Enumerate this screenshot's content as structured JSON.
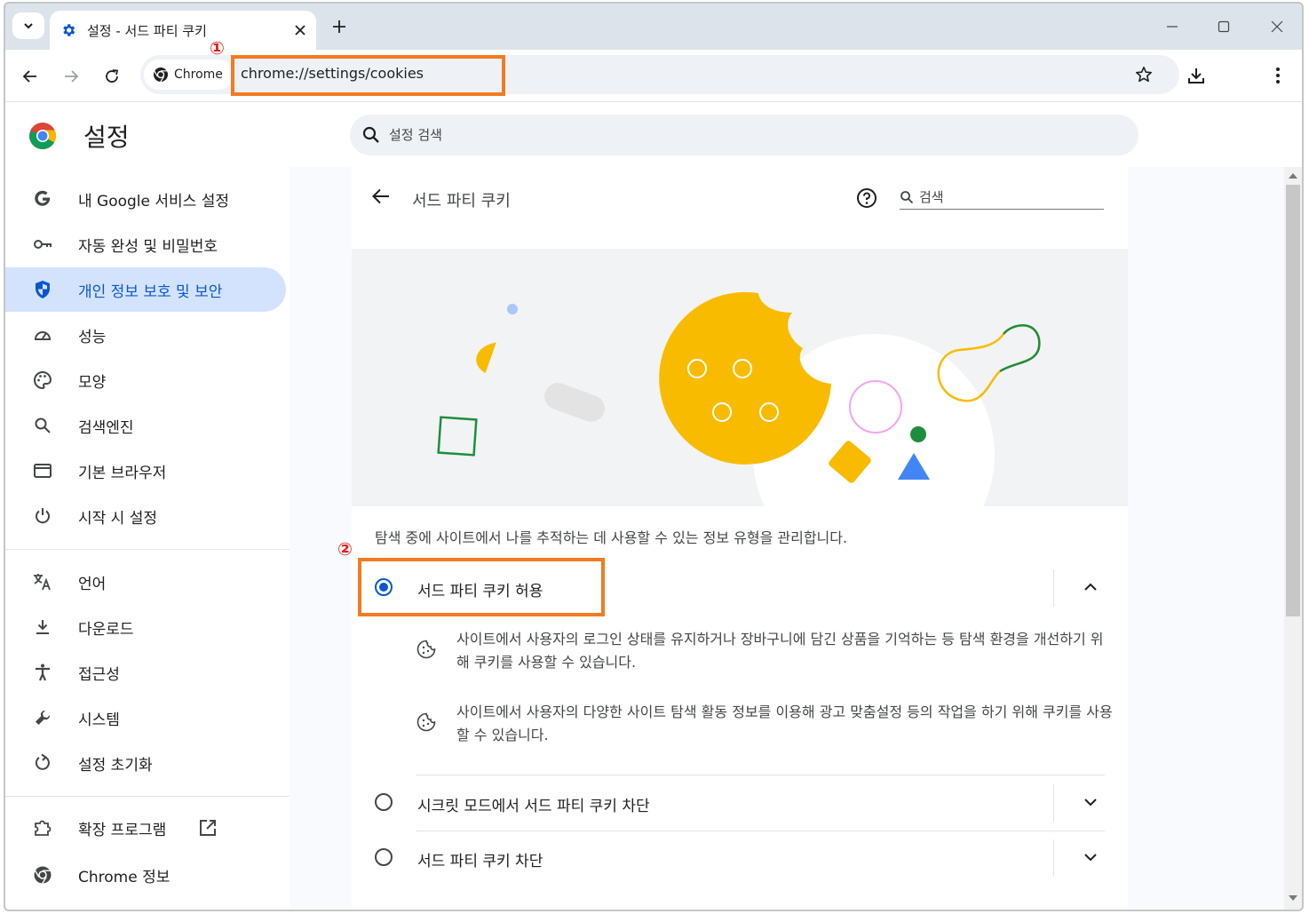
{
  "tab": {
    "title": "설정 - 서드 파티 쿠키"
  },
  "toolbar": {
    "chip_label": "Chrome",
    "url": "chrome://settings/cookies"
  },
  "annotations": {
    "mark1": "①",
    "mark2": "②",
    "highlight_color": "#f37b21",
    "mark_color": "#e0251b"
  },
  "header": {
    "title": "설정",
    "search_placeholder": "설정 검색"
  },
  "sidebar": {
    "items": [
      {
        "label": "내 Google 서비스 설정",
        "icon": "google-g-icon"
      },
      {
        "label": "자동 완성 및 비밀번호",
        "icon": "key-icon"
      },
      {
        "label": "개인 정보 보호 및 보안",
        "icon": "shield-icon",
        "active": true
      },
      {
        "label": "성능",
        "icon": "speedometer-icon"
      },
      {
        "label": "모양",
        "icon": "palette-icon"
      },
      {
        "label": "검색엔진",
        "icon": "search-icon"
      },
      {
        "label": "기본 브라우저",
        "icon": "browser-window-icon"
      },
      {
        "label": "시작 시 설정",
        "icon": "power-icon"
      },
      {
        "label": "언어",
        "icon": "translate-icon"
      },
      {
        "label": "다운로드",
        "icon": "download-icon"
      },
      {
        "label": "접근성",
        "icon": "accessibility-icon"
      },
      {
        "label": "시스템",
        "icon": "wrench-icon"
      },
      {
        "label": "설정 초기화",
        "icon": "reset-icon"
      },
      {
        "label": "확장 프로그램",
        "icon": "puzzle-icon"
      },
      {
        "label": "Chrome 정보",
        "icon": "chrome-logo-icon"
      }
    ]
  },
  "page": {
    "title": "서드 파티 쿠키",
    "search_placeholder": "검색",
    "description": "탐색 중에 사이트에서 나를 추적하는 데 사용할 수 있는 정보 유형을 관리합니다.",
    "options": [
      {
        "label": "서드 파티 쿠키 허용",
        "checked": true,
        "expanded": true
      },
      {
        "label": "시크릿 모드에서 서드 파티 쿠키 차단",
        "checked": false,
        "expanded": false
      },
      {
        "label": "서드 파티 쿠키 차단",
        "checked": false,
        "expanded": false
      }
    ],
    "details": [
      "사이트에서 사용자의 로그인 상태를 유지하거나 장바구니에 담긴 상품을 기억하는 등 탐색 환경을 개선하기 위해 쿠키를 사용할 수 있습니다.",
      "사이트에서 사용자의 다양한 사이트 탐색 활동 정보를 이용해 광고 맞춤설정 등의 작업을 하기 위해 쿠키를 사용할 수 있습니다."
    ]
  },
  "colors": {
    "accent": "#0b57d0",
    "active_nav_bg": "#d3e3fd",
    "cookie": "#f9bb00"
  }
}
